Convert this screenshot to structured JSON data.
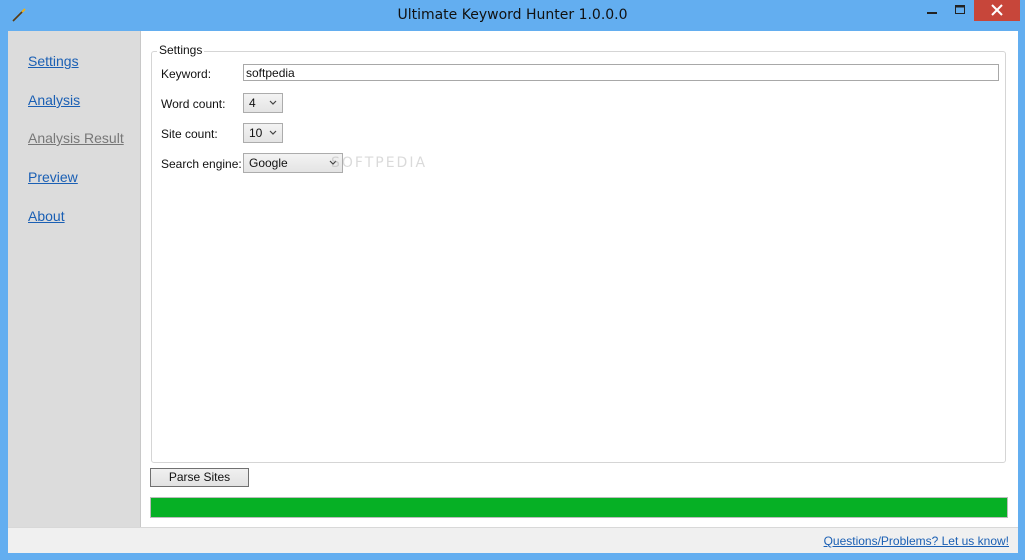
{
  "window": {
    "title": "Ultimate Keyword Hunter 1.0.0.0",
    "app_icon": "wand-icon",
    "controls": [
      "minimize-icon",
      "maximize-icon",
      "close-icon"
    ]
  },
  "sidebar": {
    "items": [
      {
        "label": "Settings",
        "active": true
      },
      {
        "label": "Analysis",
        "active": true
      },
      {
        "label": "Analysis Result",
        "active": false
      },
      {
        "label": "Preview",
        "active": true
      },
      {
        "label": "About",
        "active": true
      }
    ]
  },
  "settings": {
    "group_title": "Settings",
    "keyword_label": "Keyword:",
    "keyword_value": "softpedia",
    "word_count_label": "Word count:",
    "word_count_value": "4",
    "site_count_label": "Site count:",
    "site_count_value": "10",
    "search_engine_label": "Search engine:",
    "search_engine_value": "Google"
  },
  "actions": {
    "parse_label": "Parse Sites"
  },
  "progress": {
    "percent": 100,
    "color": "#06b025"
  },
  "status": {
    "help_link": "Questions/Problems? Let us know!"
  },
  "watermark": "SOFTPEDIA"
}
